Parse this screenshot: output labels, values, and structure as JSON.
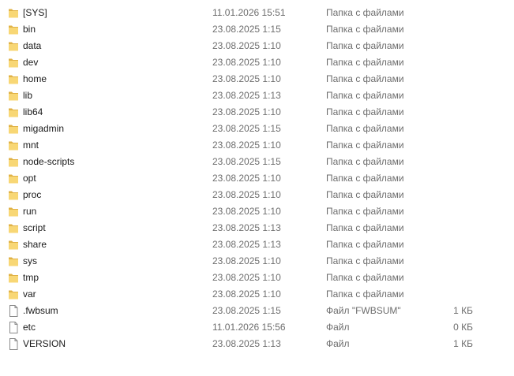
{
  "colors": {
    "folder_fill": "#f8d775",
    "folder_edge": "#e0b246",
    "file_fill": "#ffffff",
    "file_edge": "#8a8a8a",
    "meta_text": "#6d6d6d"
  },
  "items": [
    {
      "icon": "folder-icon",
      "name": "[SYS]",
      "date": "11.01.2026 15:51",
      "type": "Папка с файлами",
      "size": ""
    },
    {
      "icon": "folder-icon",
      "name": "bin",
      "date": "23.08.2025 1:15",
      "type": "Папка с файлами",
      "size": ""
    },
    {
      "icon": "folder-icon",
      "name": "data",
      "date": "23.08.2025 1:10",
      "type": "Папка с файлами",
      "size": ""
    },
    {
      "icon": "folder-icon",
      "name": "dev",
      "date": "23.08.2025 1:10",
      "type": "Папка с файлами",
      "size": ""
    },
    {
      "icon": "folder-icon",
      "name": "home",
      "date": "23.08.2025 1:10",
      "type": "Папка с файлами",
      "size": ""
    },
    {
      "icon": "folder-icon",
      "name": "lib",
      "date": "23.08.2025 1:13",
      "type": "Папка с файлами",
      "size": ""
    },
    {
      "icon": "folder-icon",
      "name": "lib64",
      "date": "23.08.2025 1:10",
      "type": "Папка с файлами",
      "size": ""
    },
    {
      "icon": "folder-icon",
      "name": "migadmin",
      "date": "23.08.2025 1:15",
      "type": "Папка с файлами",
      "size": ""
    },
    {
      "icon": "folder-icon",
      "name": "mnt",
      "date": "23.08.2025 1:10",
      "type": "Папка с файлами",
      "size": ""
    },
    {
      "icon": "folder-icon",
      "name": "node-scripts",
      "date": "23.08.2025 1:15",
      "type": "Папка с файлами",
      "size": ""
    },
    {
      "icon": "folder-icon",
      "name": "opt",
      "date": "23.08.2025 1:10",
      "type": "Папка с файлами",
      "size": ""
    },
    {
      "icon": "folder-icon",
      "name": "proc",
      "date": "23.08.2025 1:10",
      "type": "Папка с файлами",
      "size": ""
    },
    {
      "icon": "folder-icon",
      "name": "run",
      "date": "23.08.2025 1:10",
      "type": "Папка с файлами",
      "size": ""
    },
    {
      "icon": "folder-icon",
      "name": "script",
      "date": "23.08.2025 1:13",
      "type": "Папка с файлами",
      "size": ""
    },
    {
      "icon": "folder-icon",
      "name": "share",
      "date": "23.08.2025 1:13",
      "type": "Папка с файлами",
      "size": ""
    },
    {
      "icon": "folder-icon",
      "name": "sys",
      "date": "23.08.2025 1:10",
      "type": "Папка с файлами",
      "size": ""
    },
    {
      "icon": "folder-icon",
      "name": "tmp",
      "date": "23.08.2025 1:10",
      "type": "Папка с файлами",
      "size": ""
    },
    {
      "icon": "folder-icon",
      "name": "var",
      "date": "23.08.2025 1:10",
      "type": "Папка с файлами",
      "size": ""
    },
    {
      "icon": "file-icon",
      "name": ".fwbsum",
      "date": "23.08.2025 1:15",
      "type": "Файл \"FWBSUM\"",
      "size": "1 КБ"
    },
    {
      "icon": "file-icon",
      "name": "etc",
      "date": "11.01.2026 15:56",
      "type": "Файл",
      "size": "0 КБ"
    },
    {
      "icon": "file-icon",
      "name": "VERSION",
      "date": "23.08.2025 1:13",
      "type": "Файл",
      "size": "1 КБ"
    }
  ]
}
